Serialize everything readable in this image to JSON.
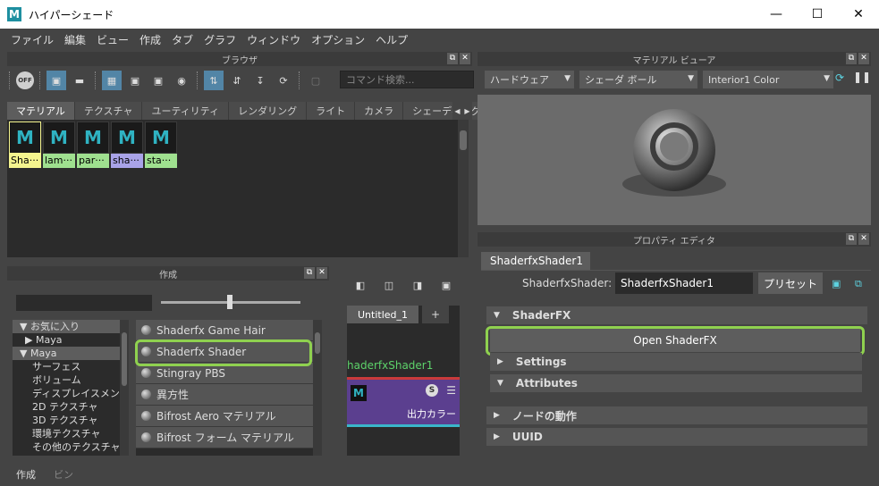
{
  "window": {
    "title": "ハイパーシェード",
    "app_letter": "M"
  },
  "menu": [
    "ファイル",
    "編集",
    "ビュー",
    "作成",
    "タブ",
    "グラフ",
    "ウィンドウ",
    "オプション",
    "ヘルプ"
  ],
  "browser": {
    "title": "ブラウザ",
    "search_placeholder": "コマンド検索...",
    "off_label": "OFF",
    "tabs": [
      "マテリアル",
      "テクスチャ",
      "ユーティリティ",
      "レンダリング",
      "ライト",
      "カメラ",
      "シェーディング グル"
    ],
    "swatches": [
      {
        "label": "Sha···",
        "color": "#f4f48e"
      },
      {
        "label": "lam···",
        "color": "#9fe08f"
      },
      {
        "label": "par···",
        "color": "#9fe08f"
      },
      {
        "label": "sha···",
        "color": "#a9a3e8"
      },
      {
        "label": "sta···",
        "color": "#9fe08f"
      }
    ]
  },
  "create": {
    "title": "作成",
    "tree": [
      "▼ お気に入り",
      "▶ Maya",
      "▼ Maya",
      "サーフェス",
      "ボリューム",
      "ディスプレイスメント",
      "2D テクスチャ",
      "3D テクスチャ",
      "環境テクスチャ",
      "その他のテクスチャ"
    ],
    "list": [
      "Shaderfx Game Hair",
      "Shaderfx Shader",
      "Stingray PBS",
      "異方性",
      "Bifrost Aero マテリアル",
      "Bifrost フォーム マテリアル"
    ],
    "bottom_tabs": [
      "作成",
      "ビン"
    ]
  },
  "node_editor": {
    "tab_label": "Untitled_1",
    "plus": "+",
    "node_name": "haderfxShader1",
    "node_letter": "M",
    "node_s": "S",
    "node_output": "出力カラー"
  },
  "material_viewer": {
    "title": "マテリアル ビューア",
    "renderer": "ハードウェア",
    "shape": "シェーダ ボール",
    "env": "Interior1 Color"
  },
  "property_editor": {
    "title": "プロパティ エディタ",
    "tab": "ShaderfxShader1",
    "field_label": "ShaderfxShader:",
    "field_value": "ShaderfxShader1",
    "preset_label": "プリセット",
    "sections": {
      "shaderfx": "ShaderFX",
      "open_button": "Open ShaderFX",
      "settings": "Settings",
      "attributes": "Attributes",
      "node_behavior": "ノードの動作",
      "uuid": "UUID"
    }
  }
}
